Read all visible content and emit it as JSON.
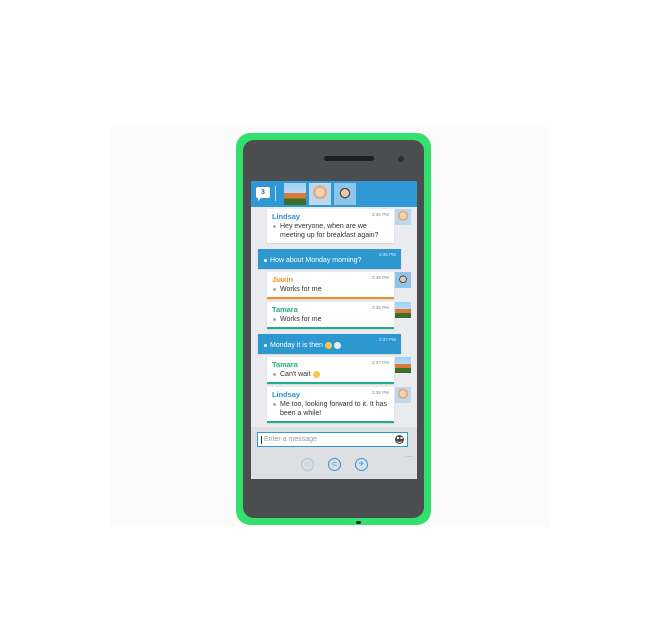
{
  "header": {
    "unread_count": "3",
    "participants": [
      "participant-1",
      "participant-2",
      "participant-3"
    ]
  },
  "messages": [
    {
      "sender": "Lindsay",
      "time": "3:35 PM",
      "text": "Hey everyone, when are we meeting up for breakfast again?",
      "own": false
    },
    {
      "sender": "",
      "time": "3:35 PM",
      "text": "How about Monday morning?",
      "own": true
    },
    {
      "sender": "Jiaxin",
      "time": "3:36 PM",
      "text": "Works for me",
      "own": false
    },
    {
      "sender": "Tamara",
      "time": "3:36 PM",
      "text": "Works for me",
      "own": false
    },
    {
      "sender": "",
      "time": "3:37 PM",
      "text": "Monday it is then",
      "own": true
    },
    {
      "sender": "Tamara",
      "time": "3:37 PM",
      "text": "Can't wait",
      "own": false
    },
    {
      "sender": "Lindsay",
      "time": "3:38 PM",
      "text": "Me too, looking forward to it. It has been a while!",
      "own": false
    }
  ],
  "compose": {
    "placeholder": "Enter a message",
    "emoticon_icon": "smiley-icon"
  },
  "app_bar": {
    "buttons": [
      {
        "icon": "chat-icon",
        "enabled": false
      },
      {
        "icon": "attach-icon",
        "enabled": true
      },
      {
        "icon": "pin-icon",
        "enabled": true
      }
    ],
    "more": "..."
  },
  "colors": {
    "accent": "#2f98d5",
    "phone_body": "#33df6d",
    "lindsay": "#2b8fcf",
    "jiaxin": "#f0902a",
    "tamara": "#1fae8d"
  }
}
